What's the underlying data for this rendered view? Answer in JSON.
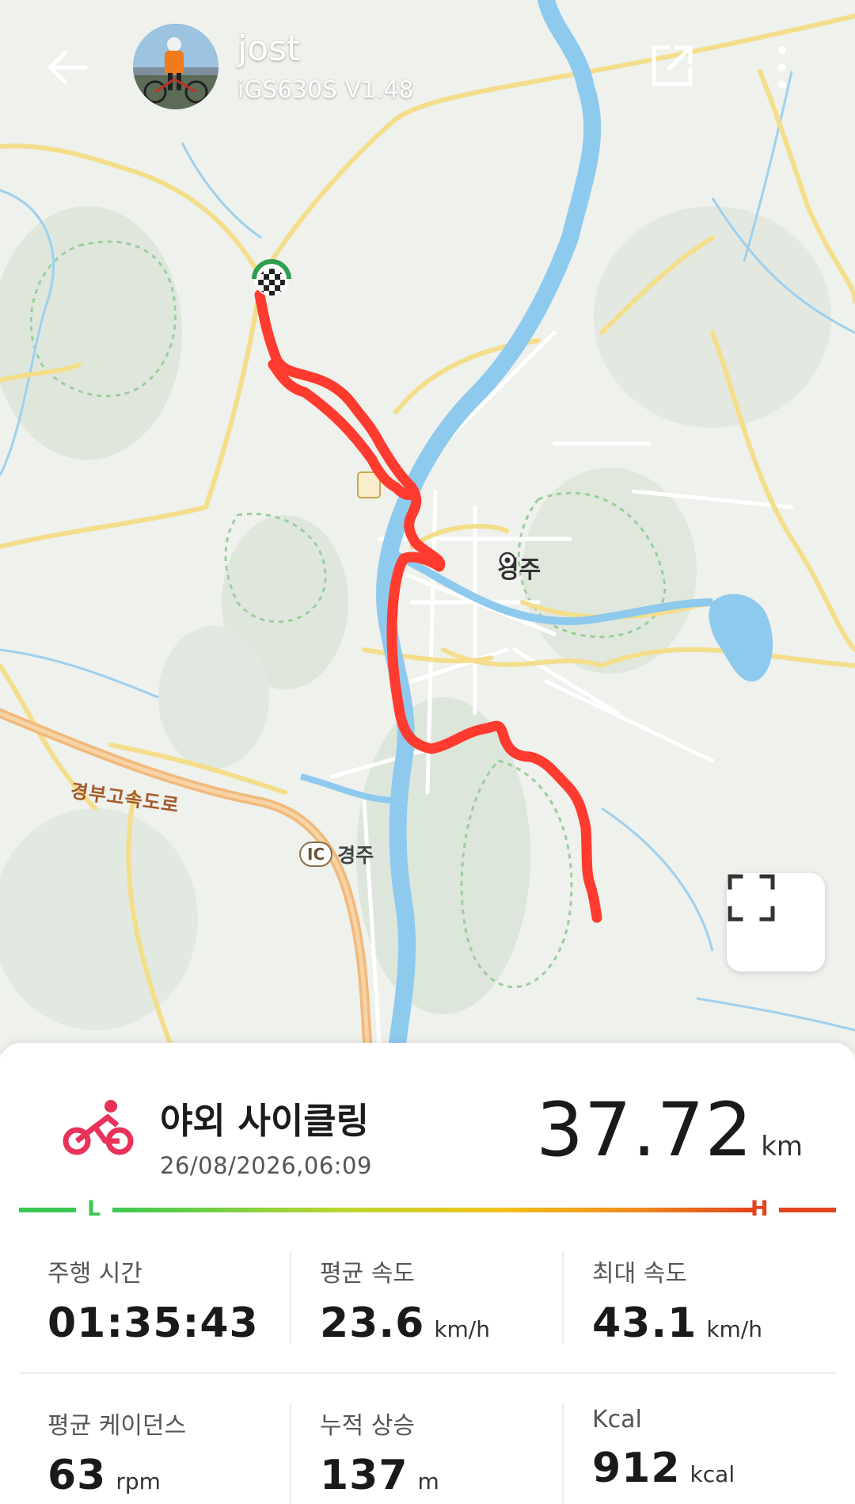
{
  "header": {
    "user_name": "jost",
    "device": "iGS630S  V1.48"
  },
  "map": {
    "city_label": "경주",
    "ic_badge": "IC",
    "ic_label": "경주",
    "highway_label": "경부고속도로",
    "route_color": "#ff3b2f",
    "water_color": "#8ec9ee"
  },
  "activity": {
    "name": "야외 사이클링",
    "date": "26/08/2026,06:09",
    "distance": "37.72",
    "distance_unit": "km",
    "accent_color": "#e8325a"
  },
  "intensity_scale": {
    "low_label": "L",
    "high_label": "H"
  },
  "stats": [
    {
      "label": "주행 시간",
      "value": "01:35:43",
      "unit": ""
    },
    {
      "label": "평균 속도",
      "value": "23.6",
      "unit": "km/h"
    },
    {
      "label": "최대 속도",
      "value": "43.1",
      "unit": "km/h"
    },
    {
      "label": "평균 케이던스",
      "value": "63",
      "unit": "rpm"
    },
    {
      "label": "누적 상승",
      "value": "137",
      "unit": "m"
    },
    {
      "label": "Kcal",
      "value": "912",
      "unit": "kcal"
    }
  ]
}
